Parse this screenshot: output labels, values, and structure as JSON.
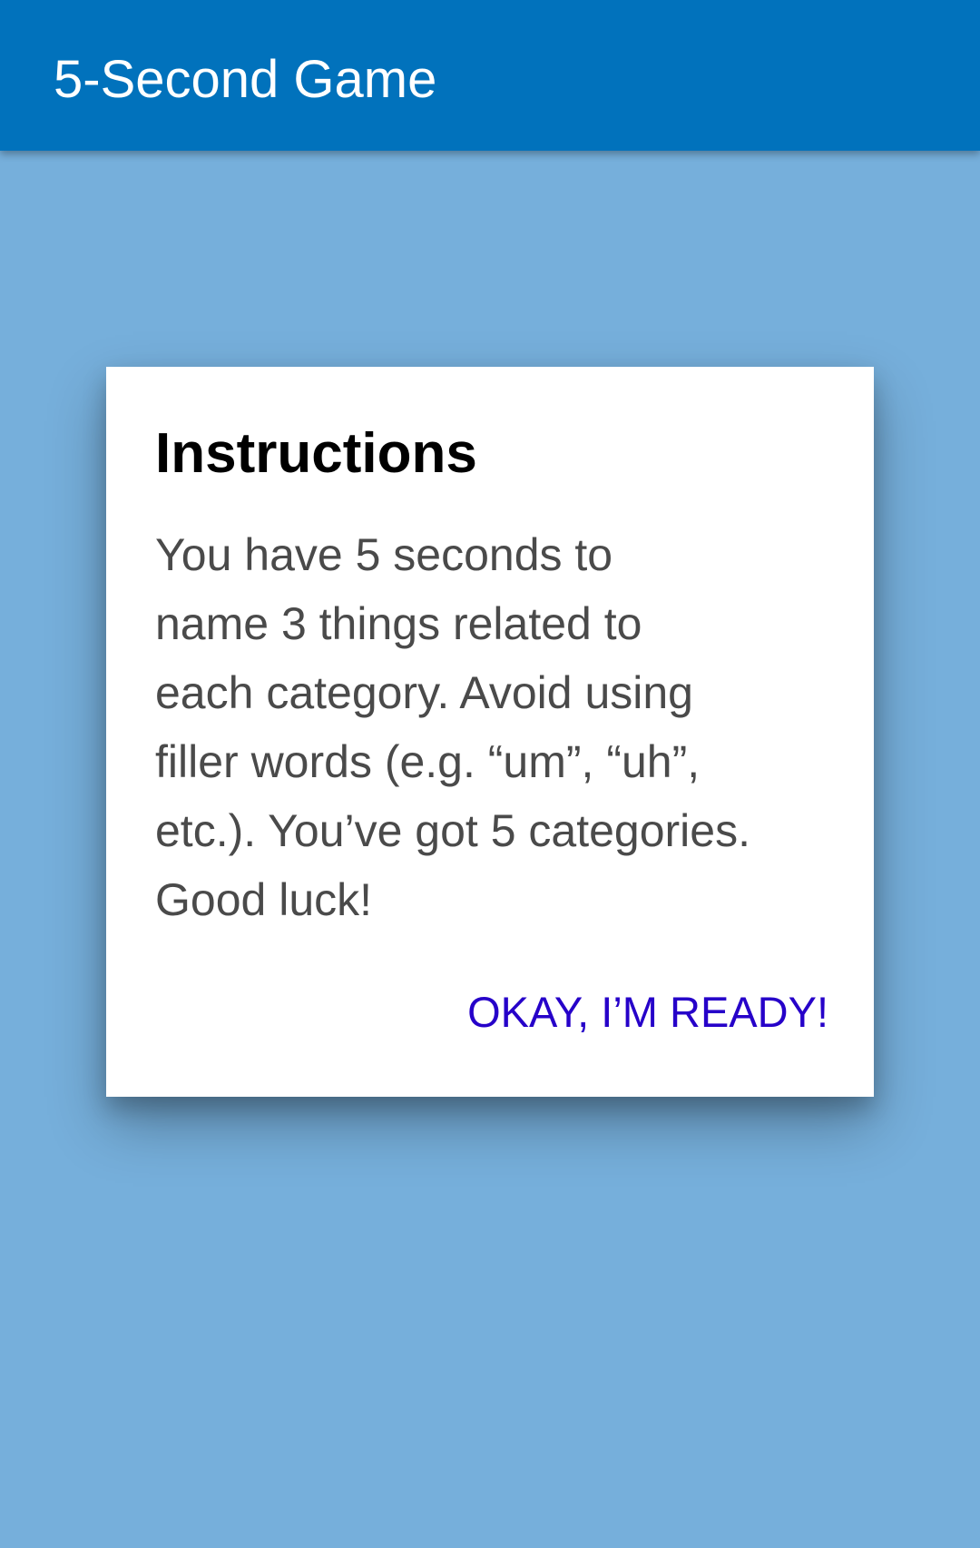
{
  "app_bar": {
    "title": "5-Second Game"
  },
  "dialog": {
    "title": "Instructions",
    "body_lines": [
      "You have 5 seconds to",
      "name 3 things related to",
      "each category. Avoid using",
      "filler words (e.g. “um”, “uh”,",
      "etc.). You’ve got 5 categories.",
      "Good luck!"
    ],
    "confirm_label": "OKAY, I’M READY!"
  },
  "colors": {
    "app_bar": "#0172bc",
    "background": "#76afdb",
    "dialog": "#ffffff",
    "accent": "#2600c9"
  }
}
